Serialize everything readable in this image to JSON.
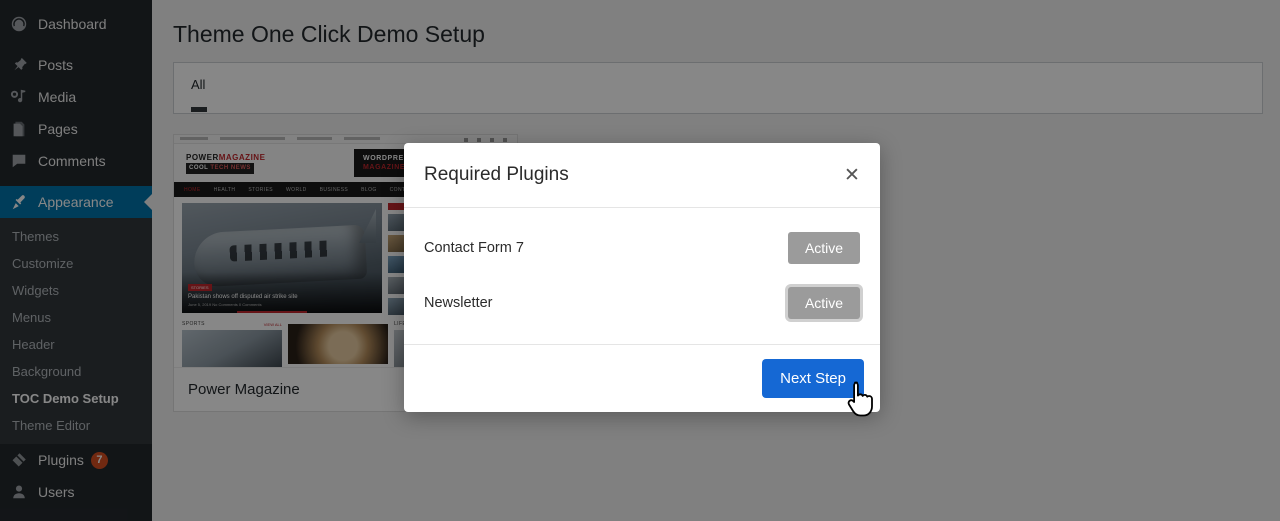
{
  "sidebar": {
    "items": [
      {
        "label": "Dashboard",
        "icon": "dashboard-icon",
        "active": false
      },
      {
        "label": "Posts",
        "icon": "pin-icon",
        "active": false
      },
      {
        "label": "Media",
        "icon": "media-icon",
        "active": false
      },
      {
        "label": "Pages",
        "icon": "pages-icon",
        "active": false
      },
      {
        "label": "Comments",
        "icon": "comments-icon",
        "active": false
      },
      {
        "label": "Appearance",
        "icon": "appearance-brush-icon",
        "active": true
      }
    ],
    "submenu": [
      {
        "label": "Themes",
        "current": false
      },
      {
        "label": "Customize",
        "current": false
      },
      {
        "label": "Widgets",
        "current": false
      },
      {
        "label": "Menus",
        "current": false
      },
      {
        "label": "Header",
        "current": false
      },
      {
        "label": "Background",
        "current": false
      },
      {
        "label": "TOC Demo Setup",
        "current": true
      },
      {
        "label": "Theme Editor",
        "current": false
      }
    ],
    "bottom_items": [
      {
        "label": "Plugins",
        "icon": "plug-icon",
        "badge": "7"
      },
      {
        "label": "Users",
        "icon": "user-icon",
        "badge": ""
      }
    ]
  },
  "page": {
    "title": "Theme One Click Demo Setup",
    "tab_all": "All"
  },
  "theme_card": {
    "name": "Power Magazine",
    "screenshot": {
      "logo_line1_a": "POWER",
      "logo_line1_b": "MAGAZINE",
      "logo_line2_a": "COOL ",
      "logo_line2_b": "TECH NEWS",
      "ad_line1": "WORDPRESS",
      "ad_line2": "MAGAZINE THEME",
      "nav": [
        "HOME",
        "HEALTH",
        "STORIES",
        "WORLD",
        "BUSINESS",
        "BLOG",
        "CONTACT"
      ],
      "hero_category": "STORIES",
      "hero_title": "Pakistan shows off disputed air strike site",
      "hero_meta": "June 5, 2019    No Comments    0 Comments",
      "section_sports": "SPORTS",
      "section_life": "LIFE",
      "view_all": "VIEW ALL"
    }
  },
  "modal": {
    "title": "Required Plugins",
    "close_icon": "close-icon",
    "plugins": [
      {
        "name": "Contact Form 7",
        "status": "Active",
        "focused": false
      },
      {
        "name": "Newsletter",
        "status": "Active",
        "focused": true
      }
    ],
    "next_button": "Next Step"
  },
  "colors": {
    "sidebar_bg": "#23282d",
    "submenu_bg": "#32373c",
    "accent_blue": "#0073aa",
    "badge_orange": "#d54e21",
    "primary_button": "#1568d4",
    "status_gray": "#9b9b9b"
  },
  "cursor": {
    "icon": "pointing-hand-cursor"
  }
}
